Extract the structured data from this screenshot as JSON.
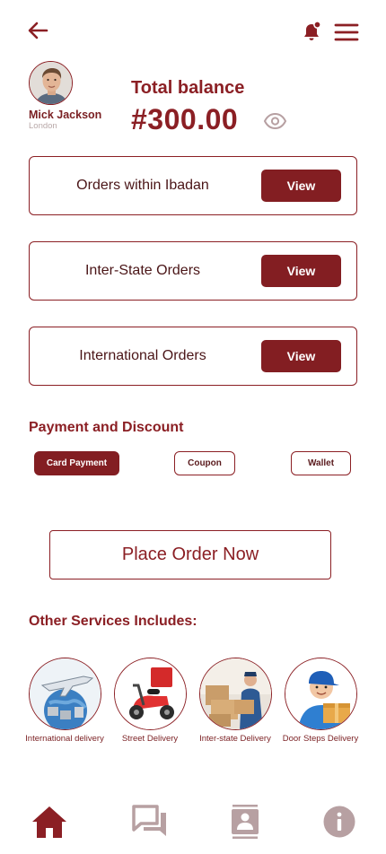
{
  "user": {
    "name": "Mick Jackson",
    "city": "London"
  },
  "balance": {
    "label": "Total balance",
    "amount": "#300.00"
  },
  "orders": [
    {
      "title": "Orders within Ibadan",
      "button": "View"
    },
    {
      "title": "Inter-State Orders",
      "button": "View"
    },
    {
      "title": "International Orders",
      "button": "View"
    }
  ],
  "payment": {
    "heading": "Payment and Discount",
    "options": [
      "Card Payment",
      "Coupon",
      "Wallet"
    ],
    "selected": "Card Payment"
  },
  "cta": {
    "place_order": "Place Order Now"
  },
  "services": {
    "heading": "Other Services Includes:",
    "items": [
      {
        "label": "International delivery",
        "icon": "airplane-cargo-image"
      },
      {
        "label": "Street Delivery",
        "icon": "scooter-image"
      },
      {
        "label": "Inter-state Delivery",
        "icon": "courier-van-image"
      },
      {
        "label": "Door Steps Delivery",
        "icon": "delivery-man-image"
      }
    ]
  },
  "nav": {
    "items": [
      "home-icon",
      "chat-icon",
      "contacts-icon",
      "info-icon"
    ],
    "active": "home-icon"
  },
  "colors": {
    "primary": "#8b1f24",
    "button": "#831e22",
    "nav_inactive": "#b7a0a2"
  }
}
